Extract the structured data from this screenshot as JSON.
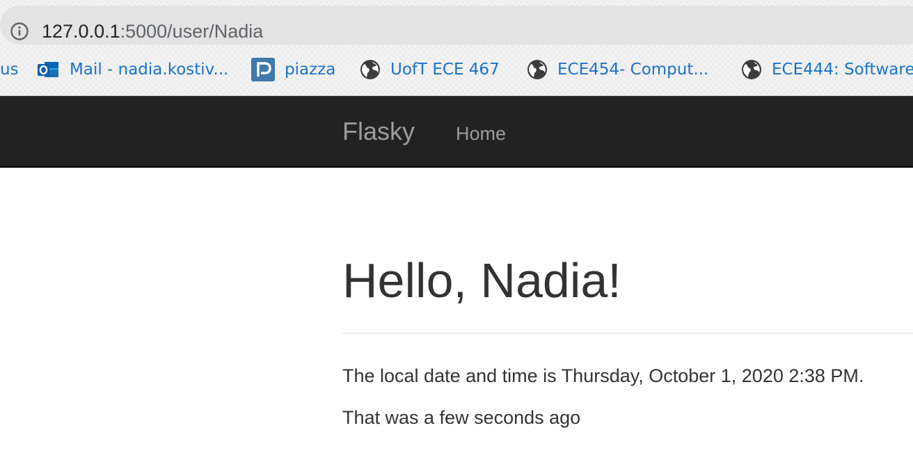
{
  "browser": {
    "url": {
      "host": "127.0.0.1",
      "path": ":5000/user/Nadia"
    },
    "info_icon": "info-icon",
    "bookmarks": [
      {
        "label": "us",
        "icon": "none"
      },
      {
        "label": "Mail - nadia.kostiv...",
        "icon": "outlook-icon"
      },
      {
        "label": "piazza",
        "icon": "piazza-icon"
      },
      {
        "label": "UofT ECE 467",
        "icon": "globe-icon"
      },
      {
        "label": "ECE454- Comput...",
        "icon": "globe-icon"
      },
      {
        "label": "ECE444: Software",
        "icon": "globe-icon"
      }
    ]
  },
  "navbar": {
    "brand": "Flasky",
    "links": [
      "Home"
    ]
  },
  "page": {
    "heading": "Hello, Nadia!",
    "paragraphs": [
      "The local date and time is Thursday, October 1, 2020 2:38 PM.",
      "That was a few seconds ago"
    ]
  },
  "colors": {
    "navbar_bg": "#222222",
    "navbar_text": "#9d9d9d",
    "bookmark_text": "#1a73c9",
    "body_text": "#333333"
  }
}
